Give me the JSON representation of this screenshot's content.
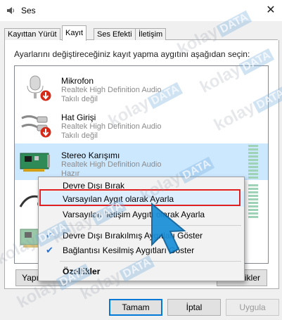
{
  "window": {
    "title": "Ses",
    "close_glyph": "✕"
  },
  "tabs": [
    {
      "label": "Kayıttan Yürüt",
      "active": false
    },
    {
      "label": "Kayıt",
      "active": true
    },
    {
      "label": "Ses Efekti",
      "active": false
    },
    {
      "label": "İletişim",
      "active": false
    }
  ],
  "instruction": "Ayarlarını değiştireceğiniz kayıt yapma aygıtını aşağıdan seçin:",
  "devices": [
    {
      "name": "Mikrofon",
      "driver": "Realtek High Definition Audio",
      "status": "Takılı değil",
      "icon": "microphone-icon",
      "badge": "red-down-arrow-icon"
    },
    {
      "name": "Hat Girişi",
      "driver": "Realtek High Definition Audio",
      "status": "Takılı değil",
      "icon": "line-in-cable-icon",
      "badge": "red-down-arrow-icon"
    },
    {
      "name": "Stereo Karışımı",
      "driver": "Realtek High Definition Audio",
      "status": "Hazır",
      "icon": "sound-card-icon",
      "selected": true
    }
  ],
  "context_menu": {
    "items": [
      {
        "label": "Devre Dışı Bırak"
      },
      {
        "label": "Varsayılan Aygıt olarak Ayarla",
        "highlighted": true
      },
      {
        "label": "Varsayılan İletişim Aygıtı olarak Ayarla"
      },
      {
        "label": "Devre Dışı Bırakılmış Aygıtları Göster",
        "checked": true
      },
      {
        "label": "Bağlantısı Kesilmiş Aygıtları Göster",
        "checked": true
      },
      {
        "label": "Özellikler",
        "bold": true
      }
    ]
  },
  "lower_buttons": {
    "configure_visible": "Yapı",
    "properties_visible": "ikler"
  },
  "footer": {
    "ok": "Tamam",
    "cancel": "İptal",
    "apply": "Uygula"
  },
  "watermark": {
    "text": "kolay",
    "box": "DATA"
  },
  "colors": {
    "selection": "#cce8ff",
    "highlight_border": "#e02020",
    "accent": "#0078d7",
    "cursor": "#1a8fd9"
  }
}
